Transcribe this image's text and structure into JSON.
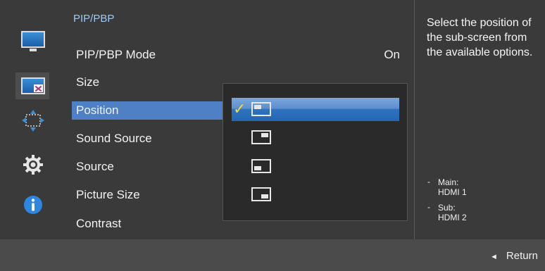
{
  "menu": {
    "title": "PIP/PBP",
    "items": [
      {
        "label": "PIP/PBP Mode",
        "value": "On"
      },
      {
        "label": "Size",
        "value": ""
      },
      {
        "label": "Position",
        "value": ""
      },
      {
        "label": "Sound Source",
        "value": ""
      },
      {
        "label": "Source",
        "value": ""
      },
      {
        "label": "Picture Size",
        "value": ""
      },
      {
        "label": "Contrast",
        "value": ""
      }
    ],
    "selected": "Position"
  },
  "sidebar": {
    "icons": [
      "picture-icon",
      "pip-pbp-icon",
      "onscreen-display-icon",
      "system-settings-icon",
      "information-icon"
    ],
    "active": "pip-pbp-icon"
  },
  "position_options": {
    "items": [
      {
        "name": "top-left",
        "selected": true
      },
      {
        "name": "top-right",
        "selected": false
      },
      {
        "name": "bottom-left",
        "selected": false
      },
      {
        "name": "bottom-right",
        "selected": false
      }
    ]
  },
  "info": {
    "description": "Select the position of the sub-screen from the available options.",
    "main_label": "Main:",
    "main_value": "HDMI 1",
    "sub_label": "Sub:",
    "sub_value": "HDMI 2"
  },
  "footer": {
    "return_label": "Return"
  },
  "colors": {
    "background": "#3a3a3a",
    "highlight": "#4f7fc5",
    "title_accent": "#9fc9f1",
    "check": "#e7df3a"
  }
}
